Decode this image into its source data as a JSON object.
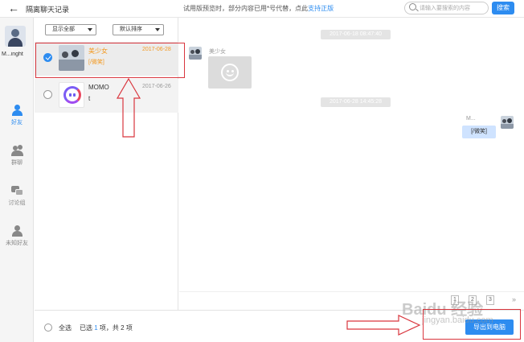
{
  "header": {
    "back_icon": "arrow-left-icon",
    "title": "隔离聊天记录",
    "trial_notice": "试用版预览时，部分内容已用*号代替，点此",
    "trial_link": "支持正版",
    "search_placeholder": "请输入要搜索的内容",
    "search_button": "搜索"
  },
  "nav": {
    "user_name": "M...inght",
    "items": [
      {
        "label": "好友",
        "icon": "person-icon",
        "active": true
      },
      {
        "label": "群聊",
        "icon": "group-icon",
        "active": false
      },
      {
        "label": "讨论组",
        "icon": "discussion-icon",
        "active": false
      },
      {
        "label": "未知好友",
        "icon": "unknown-friend-icon",
        "active": false
      }
    ]
  },
  "filters": {
    "show": "显示全部",
    "sort": "默认排序"
  },
  "contacts": [
    {
      "name": "美少女",
      "date": "2017-06-28",
      "preview": "[/微笑]",
      "selected": true
    },
    {
      "name": "MOMO",
      "name_line2": "t",
      "date": "2017-06-26",
      "selected": false
    }
  ],
  "chat": {
    "timestamps": [
      "2017-06-18 08:47:40",
      "2017-06-28 14:45:28"
    ],
    "sender_left": "美少女",
    "sender_right": "M...",
    "right_message": "[/微笑]",
    "pages": [
      "1",
      "2",
      "3"
    ]
  },
  "footer": {
    "select_all": "全选",
    "selected_prefix": "已选",
    "selected_count": "1",
    "selected_suffix": "项，共 2 项",
    "export_button": "导出到电脑"
  },
  "watermark": {
    "logo": "Baidu 经验",
    "url": "jingyan.baidu.com"
  },
  "colors": {
    "accent": "#2d8cf0",
    "highlight": "#f39a23",
    "annotation": "#d9363e"
  }
}
